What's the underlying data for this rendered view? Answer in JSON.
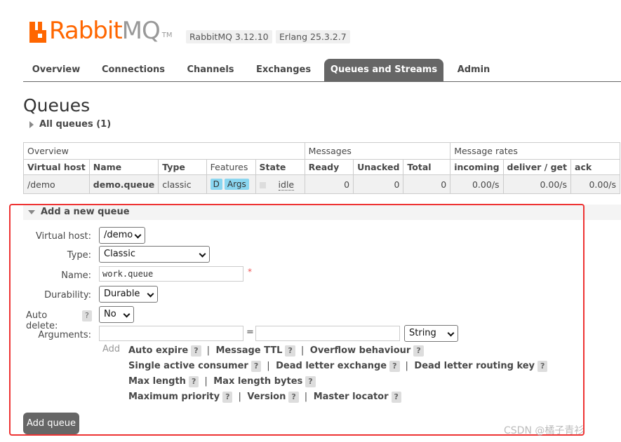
{
  "header": {
    "logo_rabbit": "Rabbit",
    "logo_mq": "MQ",
    "logo_tm": "TM",
    "rabbitmq_version": "RabbitMQ 3.12.10",
    "erlang_version": "Erlang 25.3.2.7"
  },
  "tabs": [
    {
      "label": "Overview"
    },
    {
      "label": "Connections"
    },
    {
      "label": "Channels"
    },
    {
      "label": "Exchanges"
    },
    {
      "label": "Queues and Streams",
      "active": true
    },
    {
      "label": "Admin"
    }
  ],
  "page_title": "Queues",
  "all_queues_label": "All queues (1)",
  "table": {
    "group_headers": [
      "Overview",
      "Messages",
      "Message rates"
    ],
    "columns": [
      "Virtual host",
      "Name",
      "Type",
      "Features",
      "State",
      "Ready",
      "Unacked",
      "Total",
      "incoming",
      "deliver / get",
      "ack"
    ],
    "rows": [
      {
        "virtual_host": "/demo",
        "name": "demo.queue",
        "type": "classic",
        "features": [
          "D",
          "Args"
        ],
        "state": "idle",
        "ready": "0",
        "unacked": "0",
        "total": "0",
        "incoming": "0.00/s",
        "deliver_get": "0.00/s",
        "ack": "0.00/s"
      }
    ]
  },
  "add_queue": {
    "section_title": "Add a new queue",
    "labels": {
      "virtual_host": "Virtual host:",
      "type": "Type:",
      "name": "Name:",
      "durability": "Durability:",
      "auto_delete": "Auto delete:",
      "arguments": "Arguments:"
    },
    "values": {
      "virtual_host": "/demo",
      "type": "Classic",
      "name": "work.queue",
      "durability": "Durable",
      "auto_delete": "No",
      "arg_type": "String"
    },
    "required_mark": "*",
    "help_mark": "?",
    "equals": "=",
    "add_label": "Add",
    "arg_shortcuts": [
      [
        "Auto expire",
        "Message TTL",
        "Overflow behaviour"
      ],
      [
        "Single active consumer",
        "Dead letter exchange",
        "Dead letter routing key"
      ],
      [
        "Max length",
        "Max length bytes"
      ],
      [
        "Maximum priority",
        "Version",
        "Master locator"
      ]
    ],
    "separator": "|",
    "submit_label": "Add queue"
  },
  "watermark": "CSDN @橘子青衫"
}
